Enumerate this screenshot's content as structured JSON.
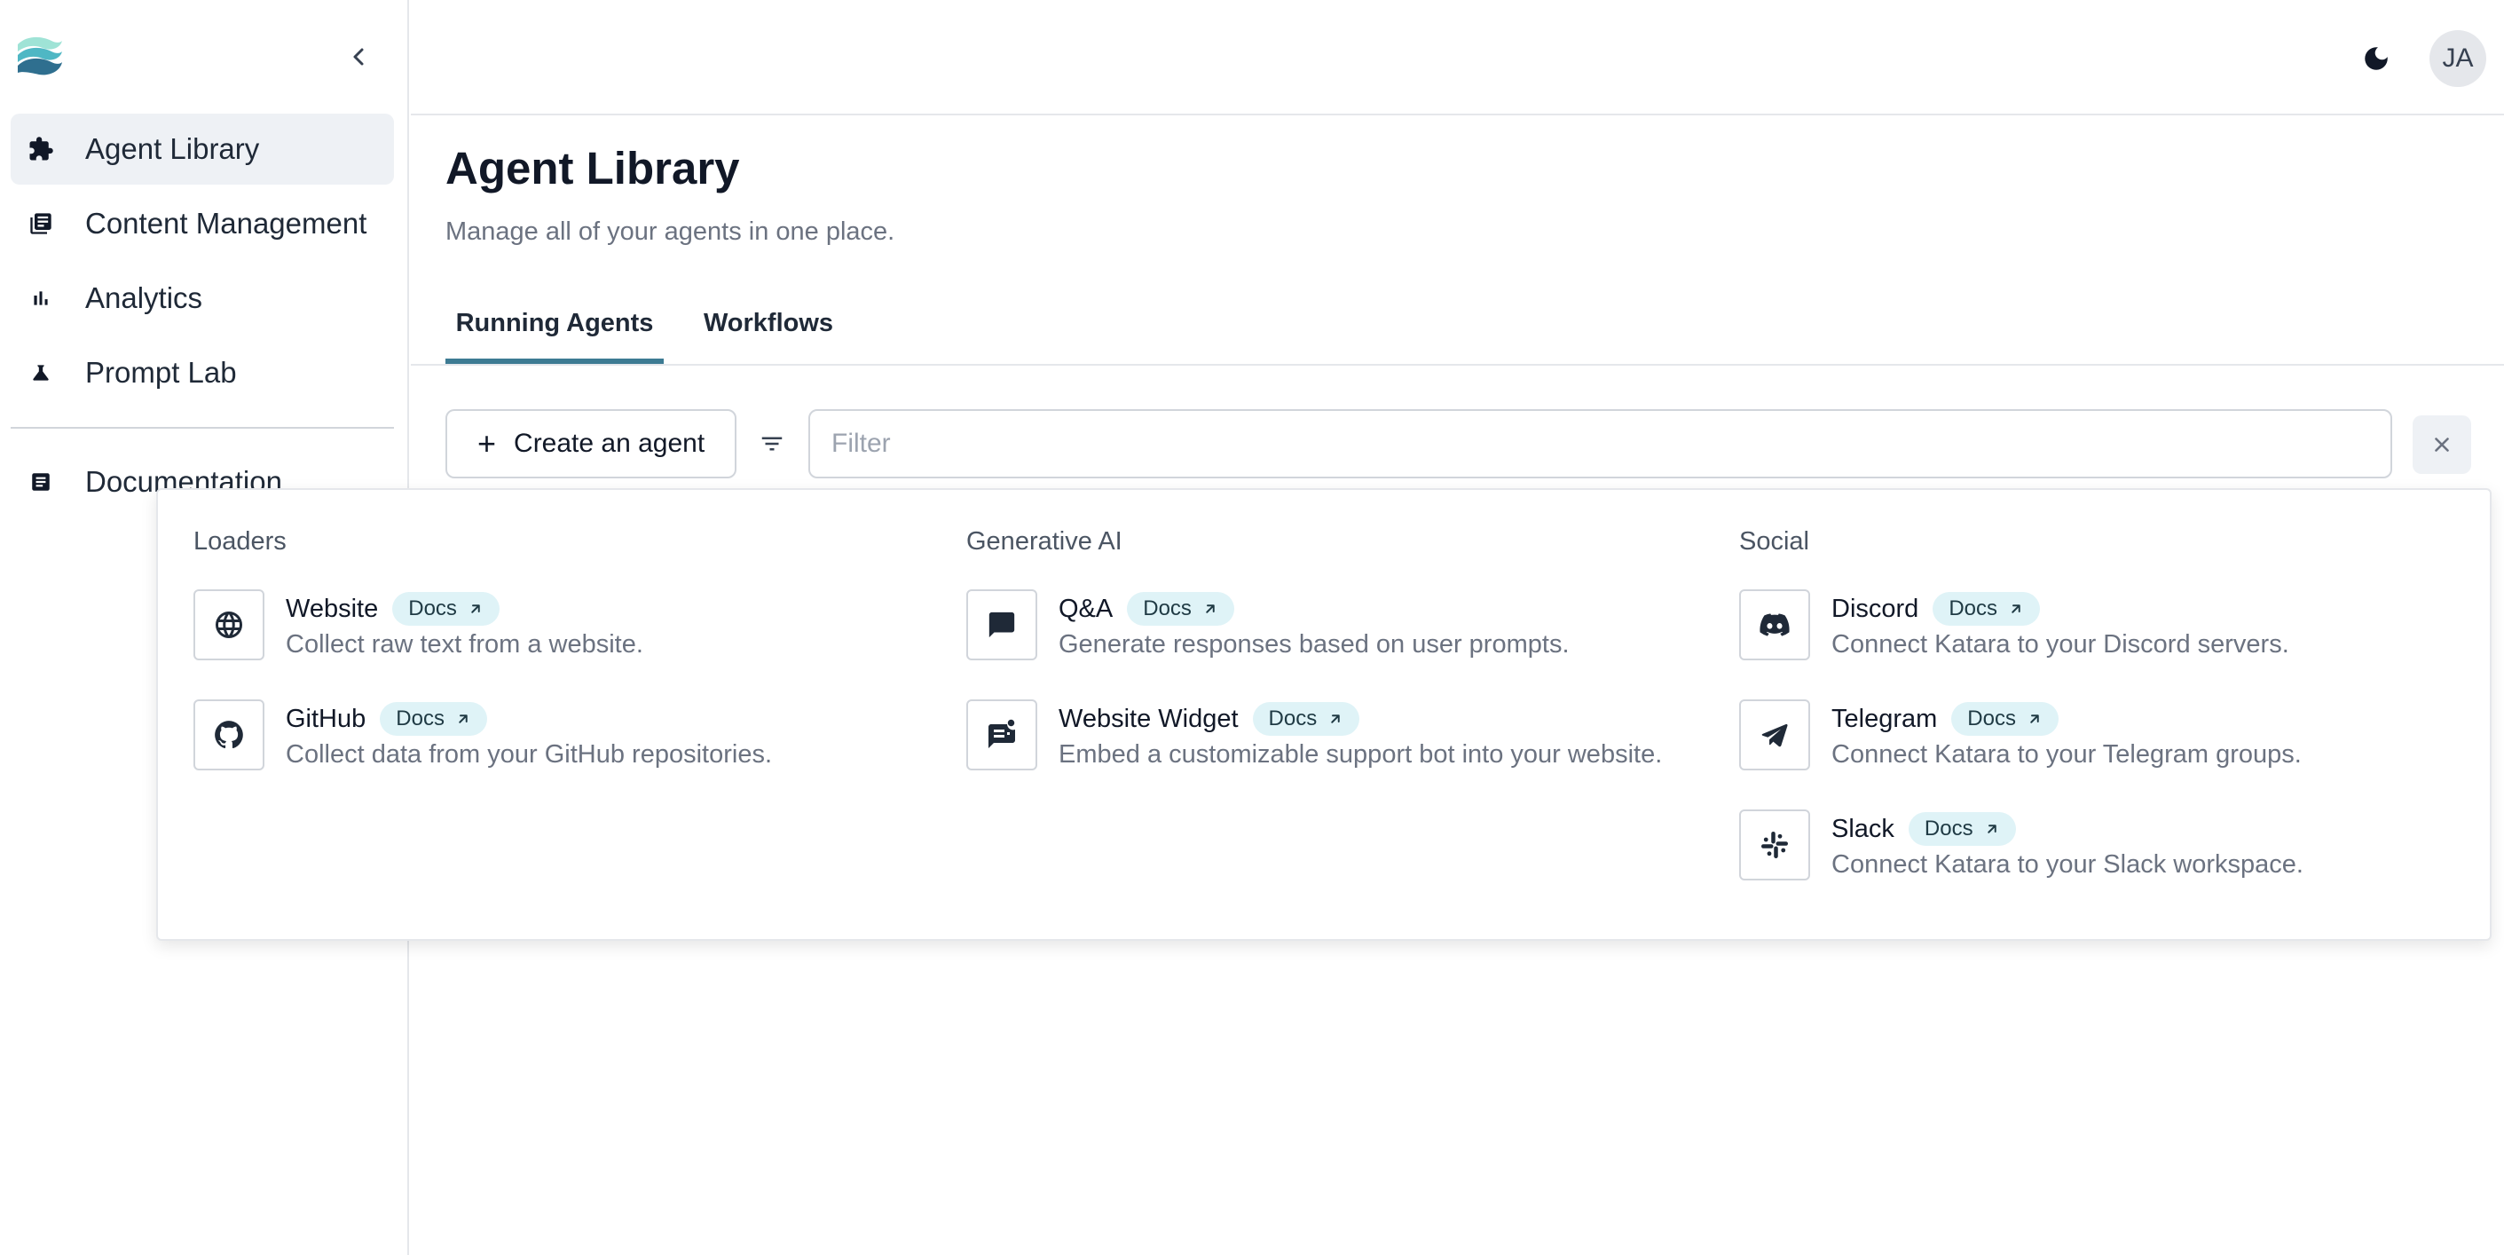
{
  "sidebar": {
    "items": [
      {
        "label": "Agent Library",
        "icon": "puzzle-icon"
      },
      {
        "label": "Content Management",
        "icon": "library-icon"
      },
      {
        "label": "Analytics",
        "icon": "bar-chart-icon"
      },
      {
        "label": "Prompt Lab",
        "icon": "flask-icon"
      }
    ],
    "documentation": {
      "label": "Documentation",
      "icon": "article-icon"
    }
  },
  "header": {
    "avatar_initials": "JA"
  },
  "main": {
    "title": "Agent Library",
    "subtitle": "Manage all of your agents in one place.",
    "tabs": [
      {
        "label": "Running Agents",
        "active": true
      },
      {
        "label": "Workflows",
        "active": false
      }
    ],
    "create_button": "Create an agent",
    "filter_placeholder": "Filter"
  },
  "menu": {
    "docs_label": "Docs",
    "columns": [
      {
        "title": "Loaders",
        "items": [
          {
            "name": "Website",
            "desc": "Collect raw text from a website.",
            "icon": "globe-icon"
          },
          {
            "name": "GitHub",
            "desc": "Collect data from your GitHub repositories.",
            "icon": "github-icon"
          }
        ]
      },
      {
        "title": "Generative AI",
        "items": [
          {
            "name": "Q&A",
            "desc": "Generate responses based on user prompts.",
            "icon": "chat-icon"
          },
          {
            "name": "Website Widget",
            "desc": "Embed a customizable support bot into your website.",
            "icon": "chat-widget-icon"
          }
        ]
      },
      {
        "title": "Social",
        "items": [
          {
            "name": "Discord",
            "desc": "Connect Katara to your Discord servers.",
            "icon": "discord-icon"
          },
          {
            "name": "Telegram",
            "desc": "Connect Katara to your Telegram groups.",
            "icon": "telegram-icon"
          },
          {
            "name": "Slack",
            "desc": "Connect Katara to your Slack workspace.",
            "icon": "slack-icon"
          }
        ]
      }
    ]
  },
  "colors": {
    "accent": "#3d7b93",
    "docs_badge": "#dff3f7",
    "active_nav": "#eef1f5"
  }
}
